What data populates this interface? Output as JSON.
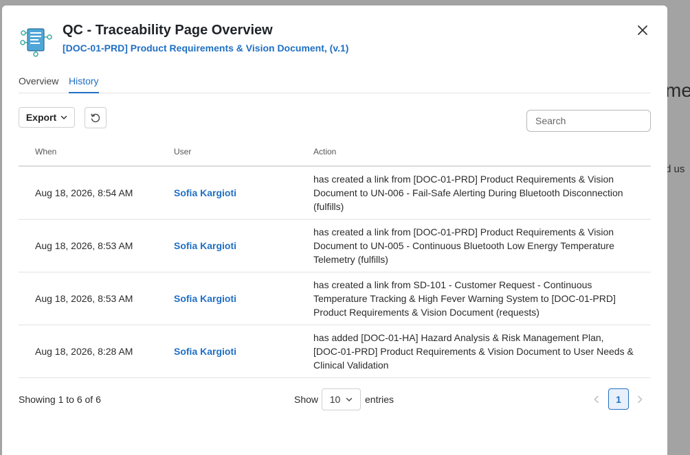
{
  "background": {
    "text_1": "me",
    "text_2": "d us"
  },
  "modal": {
    "title": "QC - Traceability Page Overview",
    "subtitle": "[DOC-01-PRD] Product Requirements & Vision Document, (v.1)",
    "close_icon": "close-icon",
    "header_icon": "traceability-document-icon"
  },
  "tabs": [
    {
      "label": "Overview",
      "active": false
    },
    {
      "label": "History",
      "active": true
    }
  ],
  "toolbar": {
    "export_label": "Export",
    "refresh_icon": "refresh-icon",
    "search_placeholder": "Search"
  },
  "table": {
    "headers": {
      "when": "When",
      "user": "User",
      "action": "Action"
    },
    "rows": [
      {
        "when": "Aug 18, 2026, 8:54 AM",
        "user": "Sofia Kargioti",
        "action": "has created a link from [DOC-01-PRD] Product Requirements & Vision Document to UN-006 - Fail-Safe Alerting During Bluetooth Disconnection (fulfills)"
      },
      {
        "when": "Aug 18, 2026, 8:53 AM",
        "user": "Sofia Kargioti",
        "action": "has created a link from [DOC-01-PRD] Product Requirements & Vision Document to UN-005 - Continuous Bluetooth Low Energy Temperature Telemetry (fulfills)"
      },
      {
        "when": "Aug 18, 2026, 8:53 AM",
        "user": "Sofia Kargioti",
        "action": "has created a link from SD-101 - Customer Request - Continuous Temperature Tracking & High Fever Warning System to [DOC-01-PRD] Product Requirements & Vision Document (requests)"
      },
      {
        "when": "Aug 18, 2026, 8:28 AM",
        "user": "Sofia Kargioti",
        "action": "has added [DOC-01-HA] Hazard Analysis & Risk Management Plan, [DOC-01-PRD] Product Requirements & Vision Document to User Needs & Clinical Validation"
      }
    ]
  },
  "footer": {
    "info": "Showing 1 to 6 of 6",
    "show_label": "Show",
    "page_size": "10",
    "entries_label": "entries",
    "current_page": "1"
  },
  "colors": {
    "accent": "#1f6fc4",
    "overlay": "#a3a3a3"
  }
}
